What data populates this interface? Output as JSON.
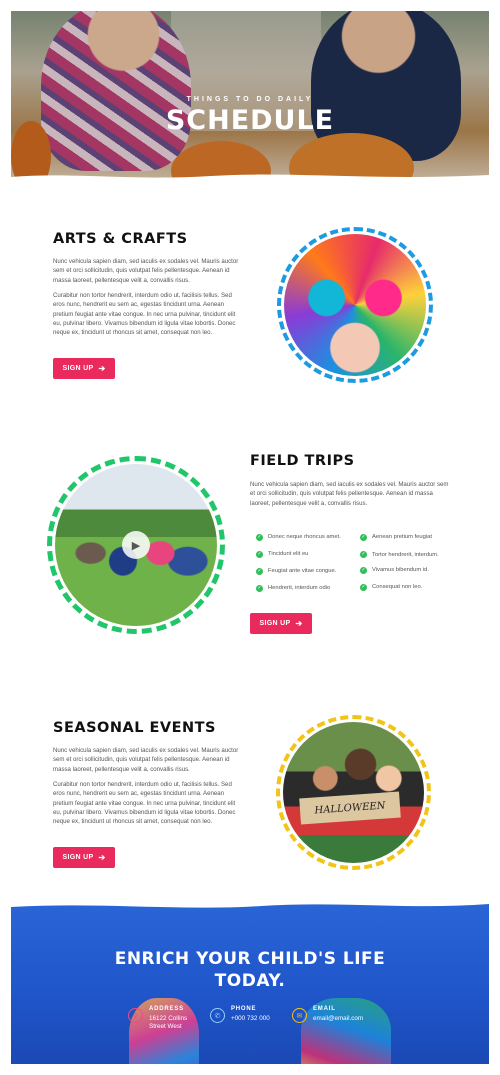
{
  "hero": {
    "kicker": "THINGS TO DO DAILY",
    "title": "SCHEDULE"
  },
  "arts": {
    "heading": "ARTS & CRAFTS",
    "para1": "Nunc vehicula sapien diam, sed iaculis ex sodales vel. Mauris auctor sem et orci sollicitudin, quis volutpat felis pellentesque. Aenean id massa laoreet, pellentesque velit a, convallis risus.",
    "para2": "Curabitur non tortor hendrerit, interdum odio ut, facilisis tellus. Sed eros nunc, hendrerit eu sem ac, egestas tincidunt urna. Aenean pretium feugiat ante vitae congue. In nec urna pulvinar, tincidunt elit eu, pulvinar libero. Vivamus bibendum id ligula vitae lobortis. Donec neque ex, tincidunt ut rhoncus sit amet, consequat non leo.",
    "button": "SIGN UP",
    "ring_color": "#1e9be0"
  },
  "trips": {
    "heading": "FIELD TRIPS",
    "para1": "Nunc vehicula sapien diam, sed iaculis ex sodales vel. Mauris auctor sem et orci sollicitudin, quis volutpat felis pellentesque. Aenean id massa laoreet, pellentesque velit a, convallis risus.",
    "list_left": [
      "Donec neque rhoncus amet.",
      "Tincidunt elit eu",
      "Feugiat ante vitae congue.",
      "Hendrerit, interdum odio"
    ],
    "list_right": [
      "Aenean pretium feugiat",
      "Tortor hendrerit, interdum.",
      "Vivamus bibendum id.",
      "Consequat non leo."
    ],
    "button": "SIGN UP",
    "ring_color": "#21c56a"
  },
  "seasonal": {
    "heading": "SEASONAL EVENTS",
    "para1": "Nunc vehicula sapien diam, sed iaculis ex sodales vel. Mauris auctor sem et orci sollicitudin, quis volutpat felis pellentesque. Aenean id massa laoreet, pellentesque velit a, convallis risus.",
    "para2": "Curabitur non tortor hendrerit, interdum odio ut, facilisis tellus. Sed eros nunc, hendrerit eu sem ac, egestas tincidunt urna. Aenean pretium feugiat ante vitae congue. In nec urna pulvinar, tincidunt elit eu, pulvinar libero. Vivamus bibendum id ligula vitae lobortis. Donec neque ex, tincidunt ut rhoncus sit amet, consequat non leo.",
    "button": "SIGN UP",
    "sign_text": "HALLOWEEN",
    "ring_color": "#f2c418"
  },
  "cta": {
    "line1": "ENRICH YOUR CHILD'S LIFE",
    "line2": "TODAY.",
    "address_label": "ADDRESS",
    "address_line1": "16122 Collins",
    "address_line2": "Street West",
    "phone_label": "PHONE",
    "phone_value": "+000 732 000",
    "email_label": "EMAIL",
    "email_value": "email@email.com"
  },
  "colors": {
    "accent": "#ea2a5c",
    "cta_bg": "#2560d4",
    "check": "#2ebf5a"
  }
}
